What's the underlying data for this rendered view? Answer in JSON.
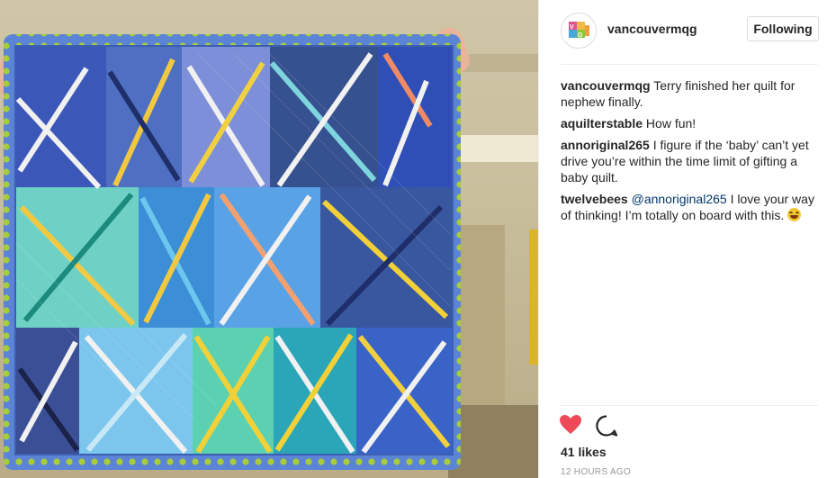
{
  "post": {
    "username": "vancouvermqg",
    "follow_label": "Following",
    "likes": "41 likes",
    "timestamp": "12 HOURS AGO"
  },
  "comments": [
    {
      "user": "vancouvermqg",
      "text": " Terry finished her quilt for nephew finally."
    },
    {
      "user": "aquilterstable",
      "text": " How fun!"
    },
    {
      "user": "annoriginal265",
      "text": " I figure if the ‘baby’ can’t yet drive you’re within the time limit of gifting a baby quilt."
    },
    {
      "user": "twelvebees",
      "mention": "@annoriginal265",
      "text": " I love your way of thinking! I’m totally on board with this. "
    }
  ],
  "icons": {
    "like": "heart-icon",
    "comment": "comment-bubble-icon",
    "avatar": "vmqg-logo-icon"
  },
  "colors": {
    "heart": "#ed4956",
    "mention": "#003569",
    "quilt_border": "#5b84d6",
    "quilt_dots": "#a8cc3c"
  }
}
